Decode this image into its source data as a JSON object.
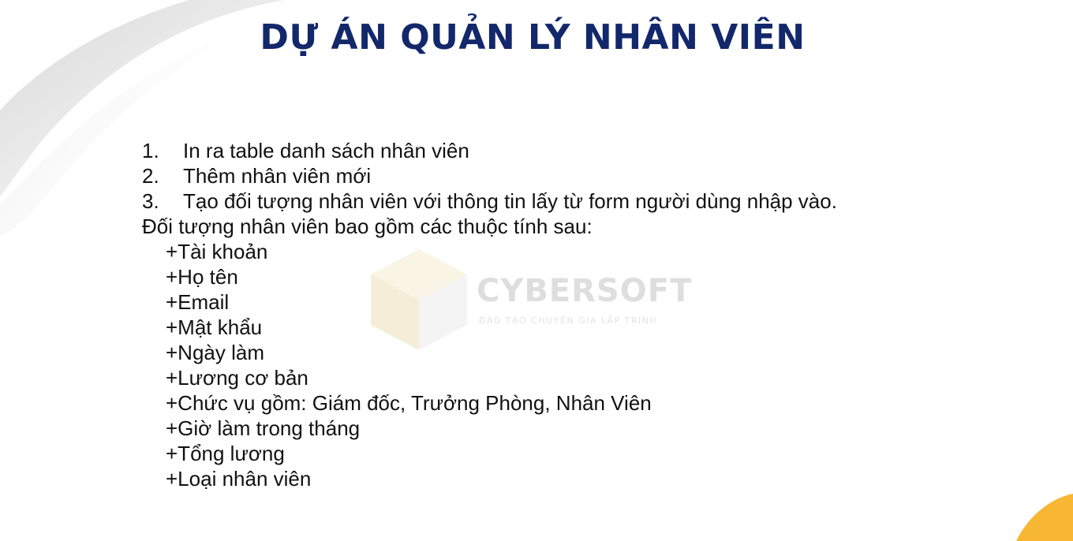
{
  "title": "DỰ ÁN QUẢN LÝ NHÂN VIÊN",
  "steps": [
    {
      "num": "1.",
      "text": "In ra table danh sách nhân viên"
    },
    {
      "num": "2.",
      "text": "Thêm nhân viên mới"
    },
    {
      "num": "3.",
      "text": "Tạo đối tượng nhân viên với thông tin lấy từ form người dùng nhập vào."
    }
  ],
  "intro": "Đối tượng nhân viên bao gồm các thuộc tính sau:",
  "attributes": [
    "+Tài khoản",
    "+Họ tên",
    "+Email",
    "+Mật khẩu",
    "+Ngày làm",
    "+Lương cơ bản",
    "+Chức vụ gồm: Giám đốc, Trưởng Phòng, Nhân Viên",
    "+Giờ làm trong tháng",
    "+Tổng lương",
    "+Loại nhân viên"
  ],
  "watermark": {
    "name": "CYBERSOFT",
    "tagline": "ĐÀO TẠO CHUYÊN GIA LẬP TRÌNH"
  },
  "colors": {
    "title": "#13286b",
    "accent": "#f7b733",
    "text": "#111111"
  }
}
